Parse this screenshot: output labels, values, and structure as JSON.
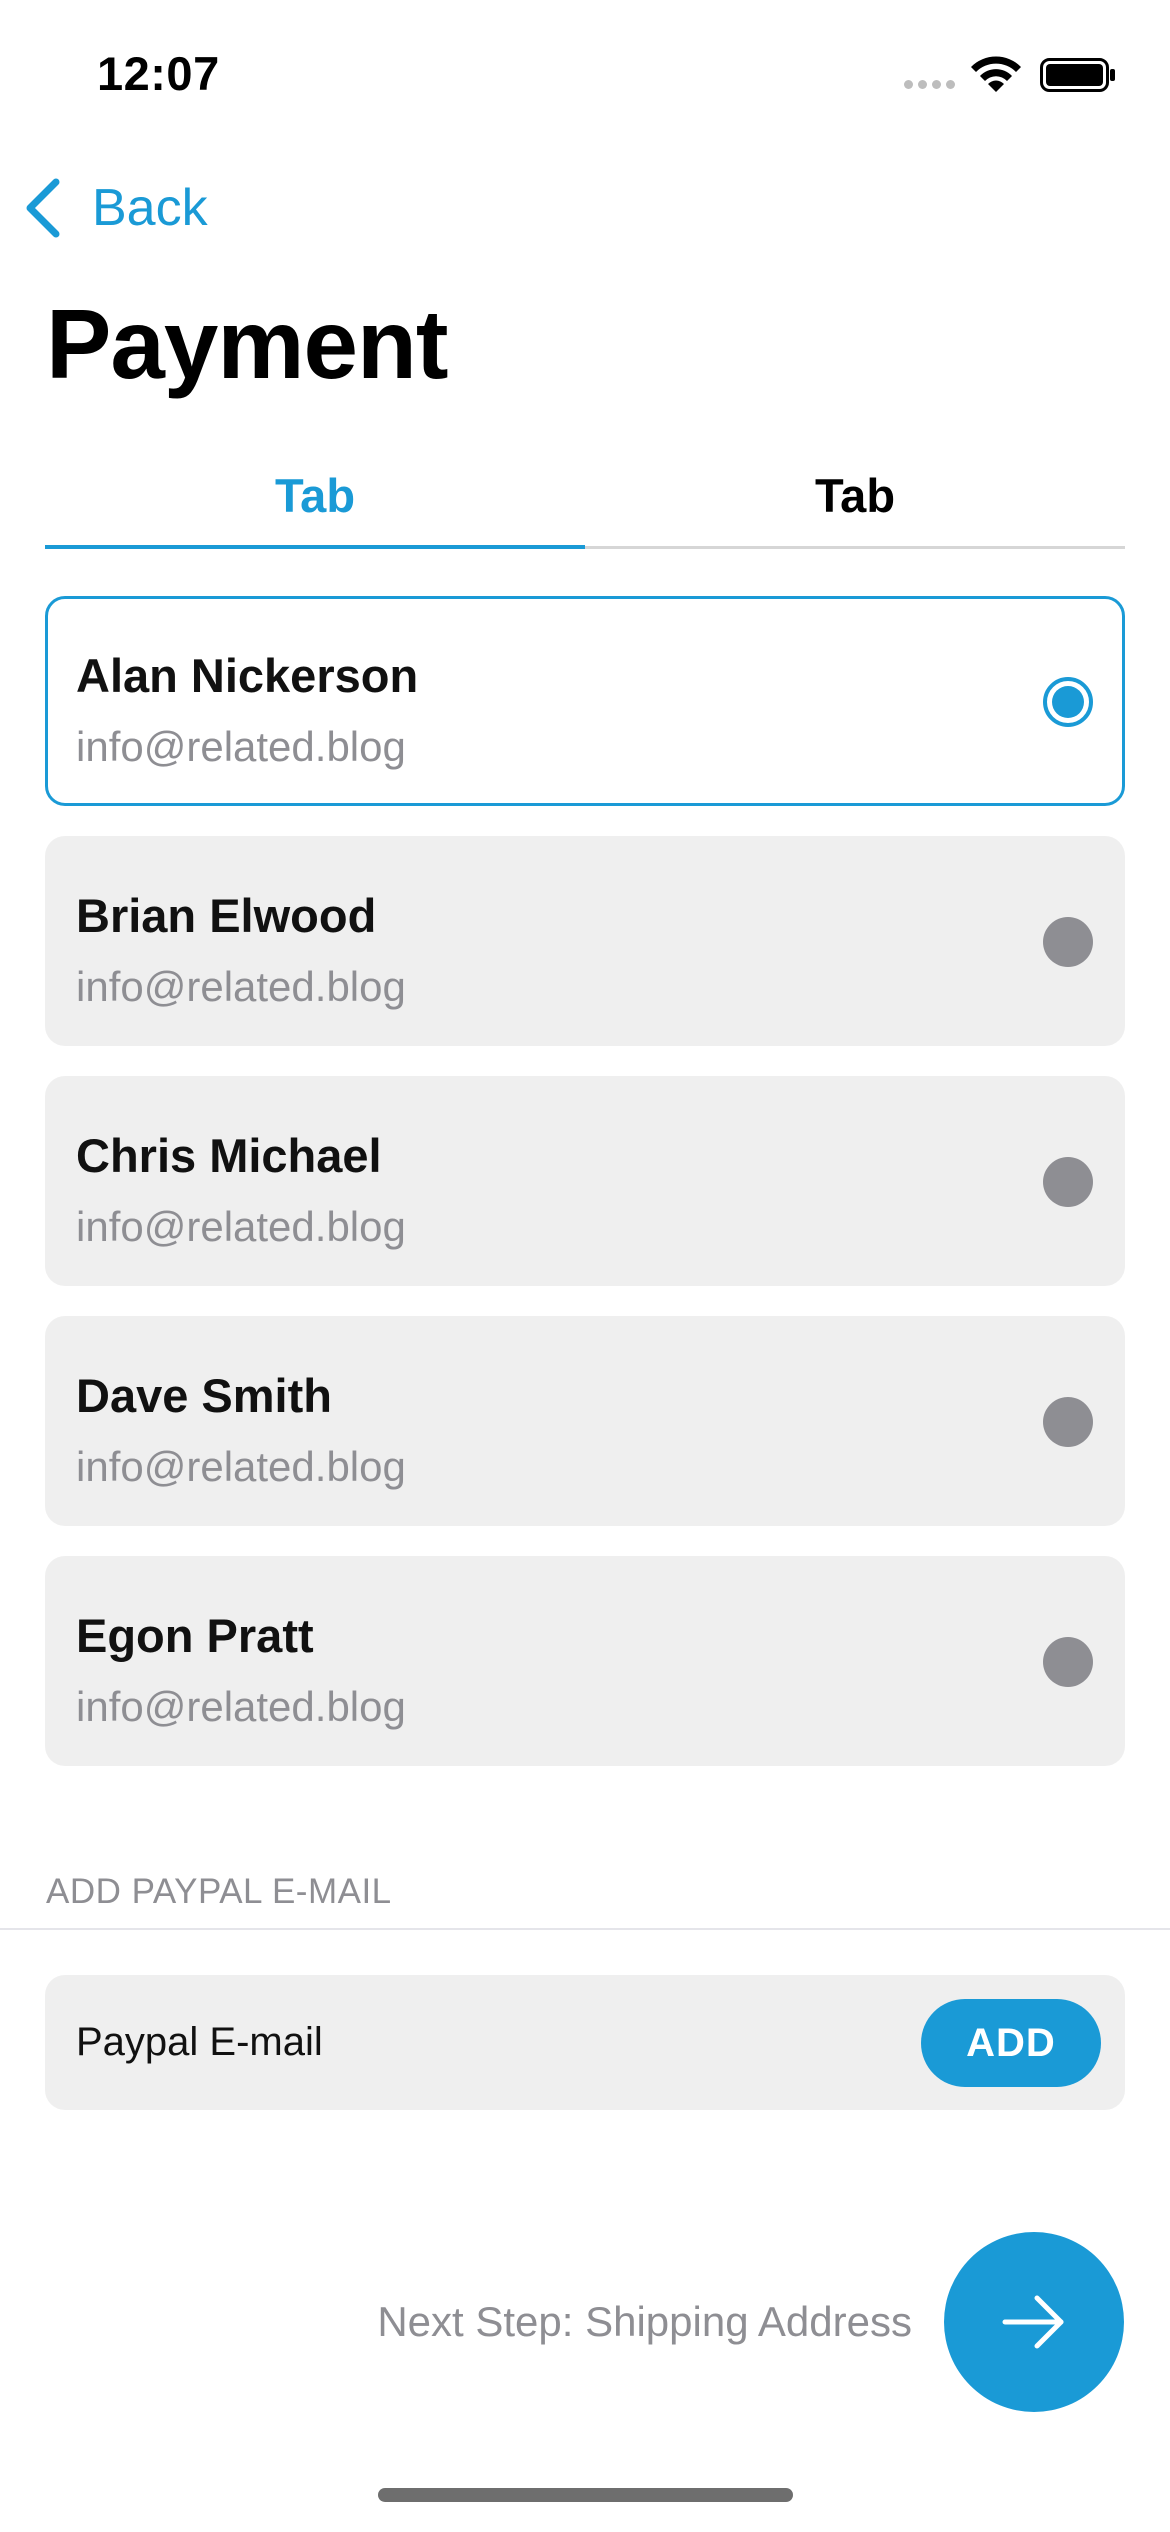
{
  "status_bar": {
    "time": "12:07",
    "icons": [
      "signal-icon",
      "wifi-icon",
      "battery-icon"
    ]
  },
  "nav": {
    "back_label": "Back",
    "back_icon": "chevron-left-icon"
  },
  "page": {
    "title": "Payment"
  },
  "tabs": [
    {
      "label": "Tab",
      "active": true
    },
    {
      "label": "Tab",
      "active": false
    }
  ],
  "accounts": [
    {
      "name": "Alan Nickerson",
      "email": "info@related.blog",
      "selected": true
    },
    {
      "name": "Brian Elwood",
      "email": "info@related.blog",
      "selected": false
    },
    {
      "name": "Chris Michael",
      "email": "info@related.blog",
      "selected": false
    },
    {
      "name": "Dave Smith",
      "email": "info@related.blog",
      "selected": false
    },
    {
      "name": "Egon Pratt",
      "email": "info@related.blog",
      "selected": false
    }
  ],
  "paypal": {
    "section_header": "ADD PAYPAL E-MAIL",
    "placeholder": "Paypal E-mail",
    "add_label": "ADD"
  },
  "footer": {
    "next_label": "Next Step: Shipping Address",
    "next_icon": "arrow-right-icon"
  },
  "colors": {
    "accent": "#1a9ad6",
    "card_bg": "#efefef",
    "secondary_text": "#8e8e93"
  }
}
